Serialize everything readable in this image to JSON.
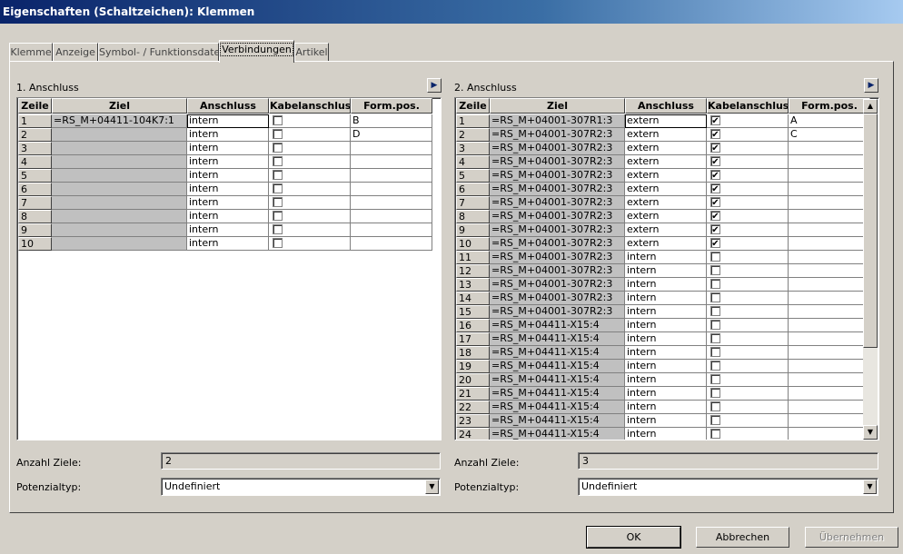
{
  "window": {
    "title": "Eigenschaften (Schaltzeichen): Klemmen"
  },
  "tabs": [
    {
      "label": "Klemme"
    },
    {
      "label": "Anzeige"
    },
    {
      "label": "Symbol- / Funktionsdaten"
    },
    {
      "label": "Verbindungen"
    },
    {
      "label": "Artikel"
    }
  ],
  "active_tab": "Verbindungen",
  "columns": [
    "Zeile",
    "Ziel",
    "Anschluss",
    "Kabelanschluss",
    "Form.pos."
  ],
  "left": {
    "title": "1. Anschluss",
    "rows": [
      {
        "zeile": "1",
        "ziel": "=RS_M+04411-104K7:1",
        "anschluss": "intern",
        "kabel": false,
        "formpos": "B"
      },
      {
        "zeile": "2",
        "ziel": "",
        "anschluss": "intern",
        "kabel": false,
        "formpos": "D"
      },
      {
        "zeile": "3",
        "ziel": "",
        "anschluss": "intern",
        "kabel": false,
        "formpos": ""
      },
      {
        "zeile": "4",
        "ziel": "",
        "anschluss": "intern",
        "kabel": false,
        "formpos": ""
      },
      {
        "zeile": "5",
        "ziel": "",
        "anschluss": "intern",
        "kabel": false,
        "formpos": ""
      },
      {
        "zeile": "6",
        "ziel": "",
        "anschluss": "intern",
        "kabel": false,
        "formpos": ""
      },
      {
        "zeile": "7",
        "ziel": "",
        "anschluss": "intern",
        "kabel": false,
        "formpos": ""
      },
      {
        "zeile": "8",
        "ziel": "",
        "anschluss": "intern",
        "kabel": false,
        "formpos": ""
      },
      {
        "zeile": "9",
        "ziel": "",
        "anschluss": "intern",
        "kabel": false,
        "formpos": ""
      },
      {
        "zeile": "10",
        "ziel": "",
        "anschluss": "intern",
        "kabel": false,
        "formpos": ""
      }
    ],
    "anzahl_label": "Anzahl Ziele:",
    "anzahl_value": "2",
    "potenzial_label": "Potenzialtyp:",
    "potenzial_value": "Undefiniert"
  },
  "right": {
    "title": "2. Anschluss",
    "rows": [
      {
        "zeile": "1",
        "ziel": "=RS_M+04001-307R1:3",
        "anschluss": "extern",
        "kabel": true,
        "formpos": "A"
      },
      {
        "zeile": "2",
        "ziel": "=RS_M+04001-307R2:3",
        "anschluss": "extern",
        "kabel": true,
        "formpos": "C"
      },
      {
        "zeile": "3",
        "ziel": "=RS_M+04001-307R2:3",
        "anschluss": "extern",
        "kabel": true,
        "formpos": ""
      },
      {
        "zeile": "4",
        "ziel": "=RS_M+04001-307R2:3",
        "anschluss": "extern",
        "kabel": true,
        "formpos": ""
      },
      {
        "zeile": "5",
        "ziel": "=RS_M+04001-307R2:3",
        "anschluss": "extern",
        "kabel": true,
        "formpos": ""
      },
      {
        "zeile": "6",
        "ziel": "=RS_M+04001-307R2:3",
        "anschluss": "extern",
        "kabel": true,
        "formpos": ""
      },
      {
        "zeile": "7",
        "ziel": "=RS_M+04001-307R2:3",
        "anschluss": "extern",
        "kabel": true,
        "formpos": ""
      },
      {
        "zeile": "8",
        "ziel": "=RS_M+04001-307R2:3",
        "anschluss": "extern",
        "kabel": true,
        "formpos": ""
      },
      {
        "zeile": "9",
        "ziel": "=RS_M+04001-307R2:3",
        "anschluss": "extern",
        "kabel": true,
        "formpos": ""
      },
      {
        "zeile": "10",
        "ziel": "=RS_M+04001-307R2:3",
        "anschluss": "extern",
        "kabel": true,
        "formpos": ""
      },
      {
        "zeile": "11",
        "ziel": "=RS_M+04001-307R2:3",
        "anschluss": "intern",
        "kabel": false,
        "formpos": ""
      },
      {
        "zeile": "12",
        "ziel": "=RS_M+04001-307R2:3",
        "anschluss": "intern",
        "kabel": false,
        "formpos": ""
      },
      {
        "zeile": "13",
        "ziel": "=RS_M+04001-307R2:3",
        "anschluss": "intern",
        "kabel": false,
        "formpos": ""
      },
      {
        "zeile": "14",
        "ziel": "=RS_M+04001-307R2:3",
        "anschluss": "intern",
        "kabel": false,
        "formpos": ""
      },
      {
        "zeile": "15",
        "ziel": "=RS_M+04001-307R2:3",
        "anschluss": "intern",
        "kabel": false,
        "formpos": ""
      },
      {
        "zeile": "16",
        "ziel": "=RS_M+04411-X15:4",
        "anschluss": "intern",
        "kabel": false,
        "formpos": ""
      },
      {
        "zeile": "17",
        "ziel": "=RS_M+04411-X15:4",
        "anschluss": "intern",
        "kabel": false,
        "formpos": ""
      },
      {
        "zeile": "18",
        "ziel": "=RS_M+04411-X15:4",
        "anschluss": "intern",
        "kabel": false,
        "formpos": ""
      },
      {
        "zeile": "19",
        "ziel": "=RS_M+04411-X15:4",
        "anschluss": "intern",
        "kabel": false,
        "formpos": ""
      },
      {
        "zeile": "20",
        "ziel": "=RS_M+04411-X15:4",
        "anschluss": "intern",
        "kabel": false,
        "formpos": ""
      },
      {
        "zeile": "21",
        "ziel": "=RS_M+04411-X15:4",
        "anschluss": "intern",
        "kabel": false,
        "formpos": ""
      },
      {
        "zeile": "22",
        "ziel": "=RS_M+04411-X15:4",
        "anschluss": "intern",
        "kabel": false,
        "formpos": ""
      },
      {
        "zeile": "23",
        "ziel": "=RS_M+04411-X15:4",
        "anschluss": "intern",
        "kabel": false,
        "formpos": ""
      },
      {
        "zeile": "24",
        "ziel": "=RS_M+04411-X15:4",
        "anschluss": "intern",
        "kabel": false,
        "formpos": ""
      }
    ],
    "anzahl_label": "Anzahl Ziele:",
    "anzahl_value": "3",
    "potenzial_label": "Potenzialtyp:",
    "potenzial_value": "Undefiniert"
  },
  "buttons": {
    "ok": "OK",
    "cancel": "Abbrechen",
    "apply": "Übernehmen"
  },
  "icons": {
    "expand": "play-arrow-icon",
    "dropdown": "chevron-down-icon",
    "checkbox": "checkmark-icon"
  },
  "colors": {
    "titlebar": "#0a246a",
    "face": "#d4d0c8",
    "gray_cell": "#c0c0c0"
  }
}
